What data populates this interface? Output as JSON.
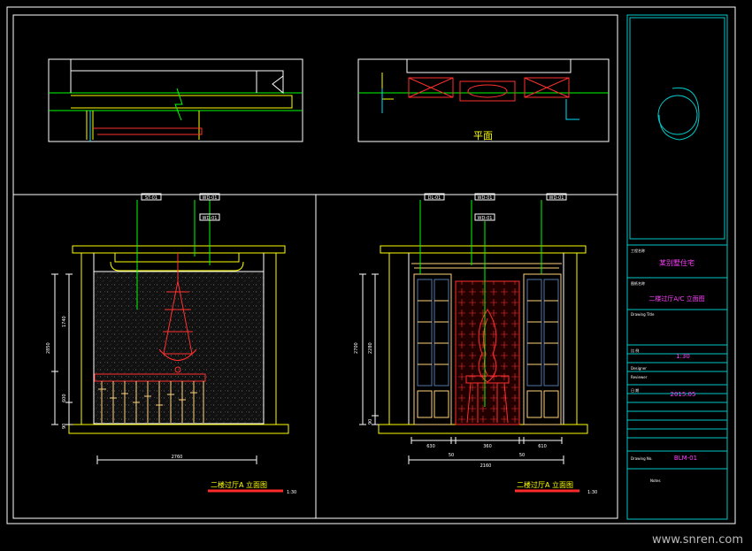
{
  "colors": {
    "background": "#000000",
    "frame": "#ffffff",
    "title_block": "#00c8c8",
    "wall": "#ffff00",
    "dimension": "#00ff00",
    "furniture_red": "#ff2a2a",
    "wood": "#ffd27a",
    "glass": "#5577aa",
    "texture": "#505050",
    "label_magenta": "#ff40ff",
    "watermark": "#bbbbbb"
  },
  "plan_label": "平面",
  "elevations": [
    {
      "title": "二楼过厅A 立面图",
      "scale": "1:30",
      "tags": [
        "ST-01",
        "WD-01",
        "WD-01"
      ],
      "dims": {
        "total_width": "2760",
        "height": "2850",
        "h_top": "1740",
        "h_mid": "600",
        "h_base": "90"
      }
    },
    {
      "title": "二楼过厅A 立面图",
      "scale": "1:30",
      "tags": [
        "DL-01",
        "WD-01",
        "WD-01",
        "WD-01"
      ],
      "dims": {
        "total_width": "2160",
        "height": "2700",
        "h_top": "2280",
        "h_base": "90",
        "seg_a": "630",
        "seg_b": "360",
        "seg_c": "610",
        "seg_d": "50",
        "seg_e": "50"
      }
    }
  ],
  "title_block": {
    "project_label": "工程名称",
    "project_name": "某别墅住宅",
    "drawing_label": "图纸名称",
    "drawing_name": "二楼过厅A/C 立面图",
    "drawing_sub": "Drawing Title",
    "scale_label": "比 例",
    "scale": "1:30",
    "designer_label": "Designer",
    "reviewer_label": "Reviewer",
    "date_label": "日 期",
    "date": "2015.05",
    "number_label": "Drawing No.",
    "number": "BLM-01",
    "notes_label": "Notes"
  },
  "watermark": "www.snren.com"
}
